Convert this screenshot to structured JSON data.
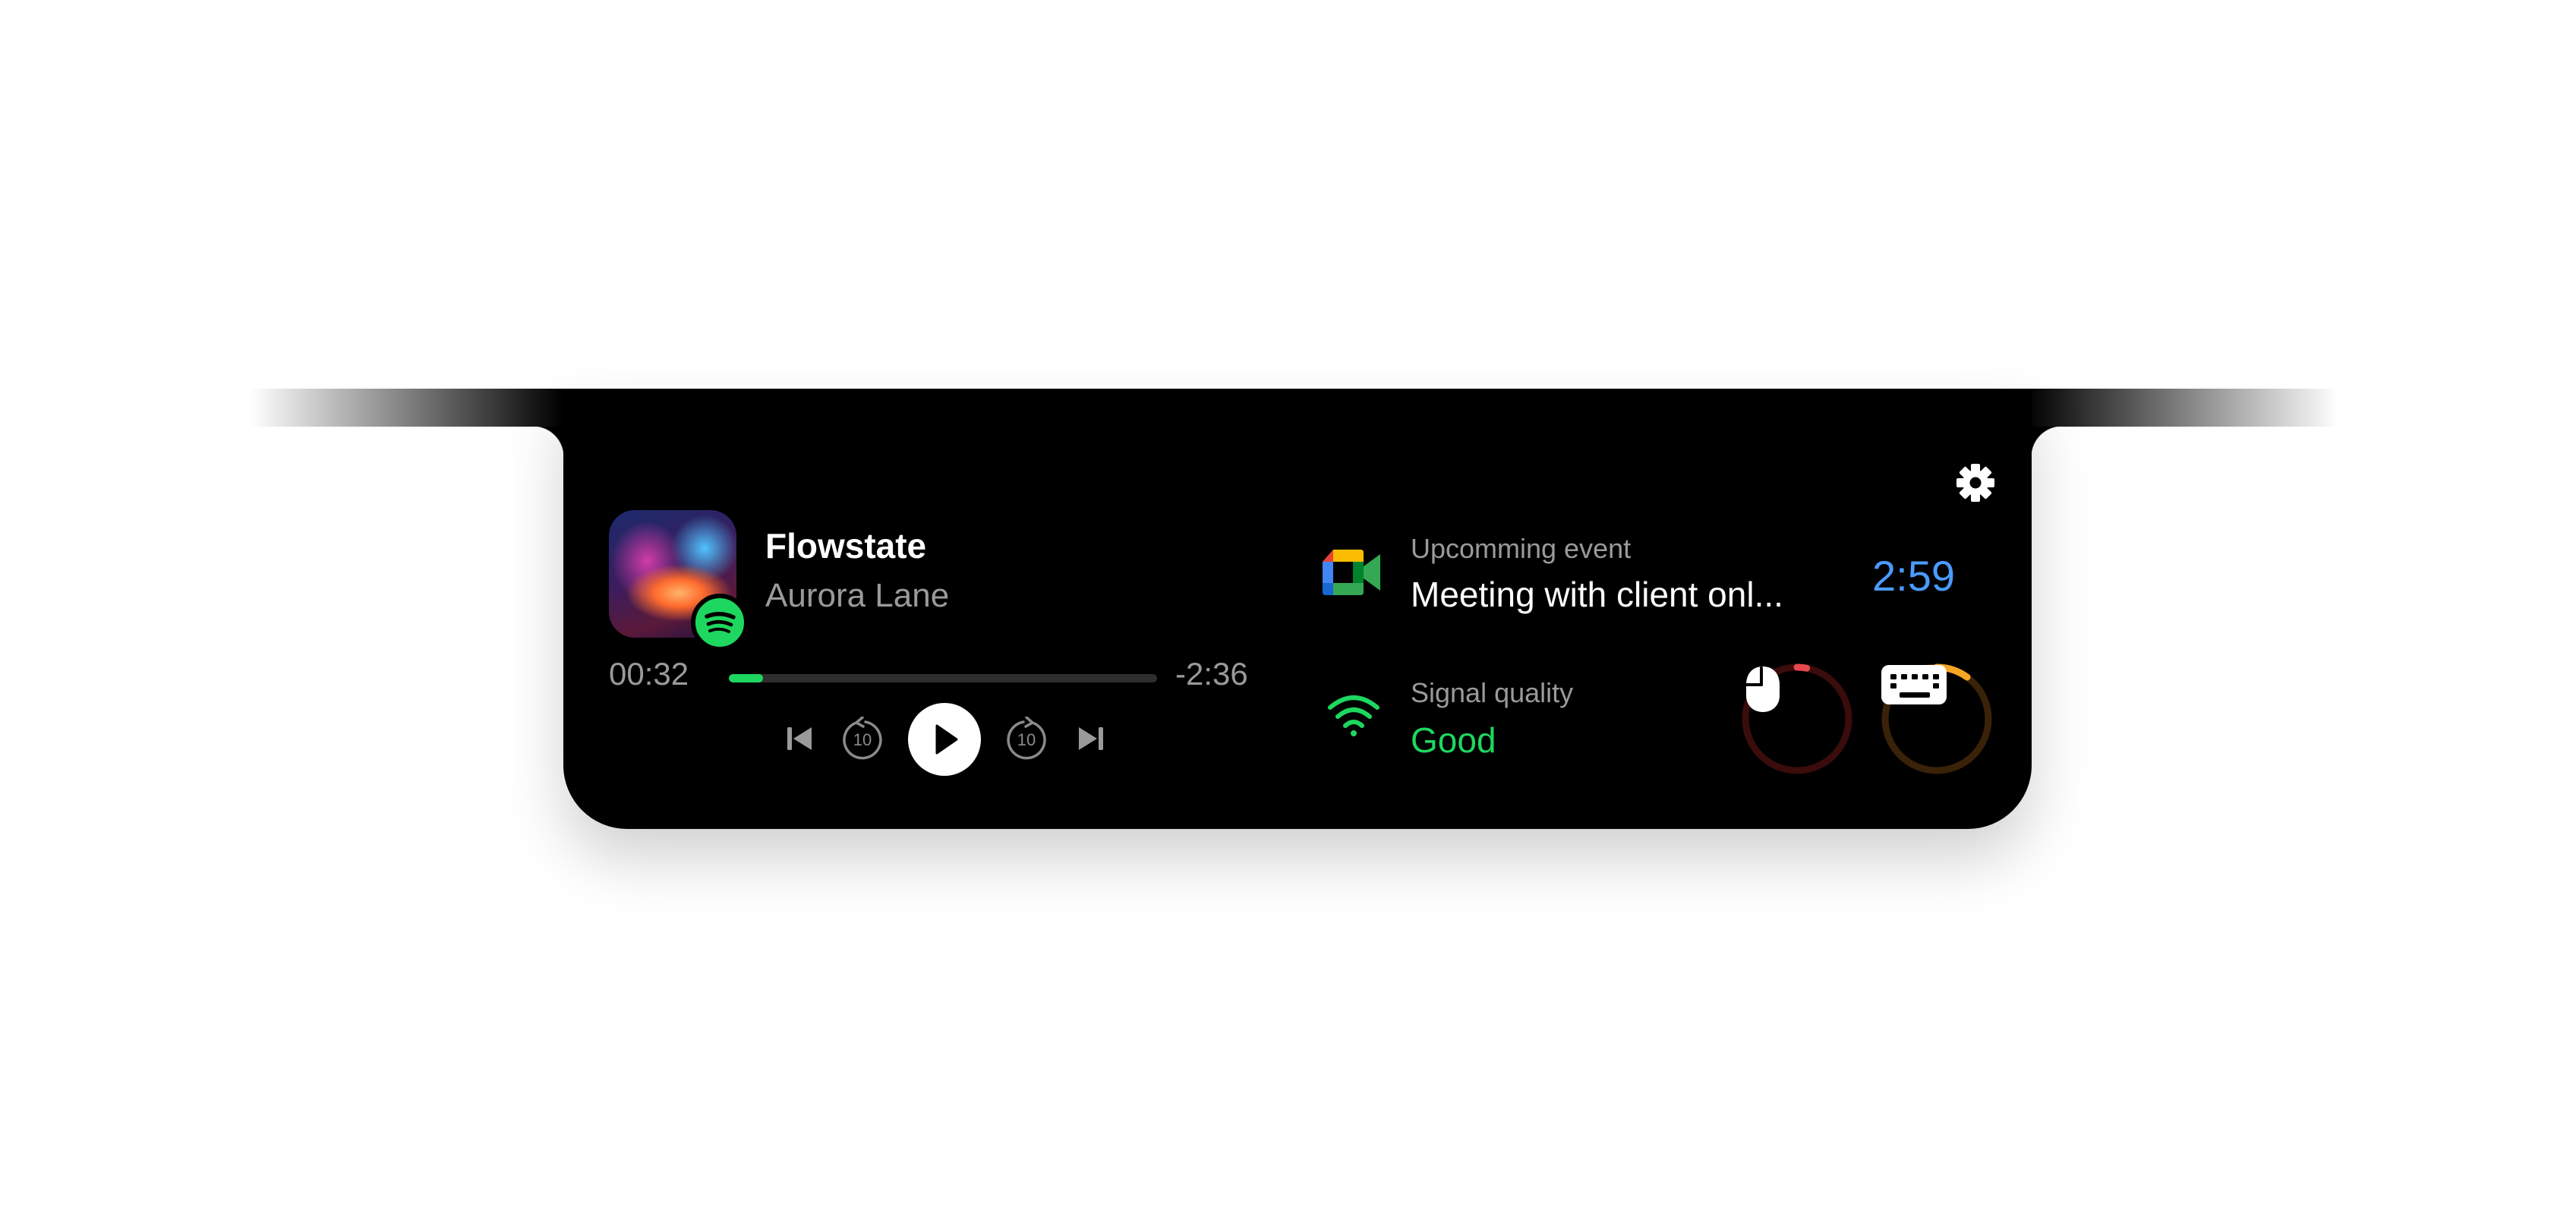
{
  "player": {
    "title": "Flowstate",
    "artist": "Aurora Lane",
    "elapsed": "00:32",
    "remaining": "-2:36",
    "progress": 0.08,
    "source_icon": "spotify-icon",
    "accent_color": "#1ed760",
    "skip_back_label": "10",
    "skip_forward_label": "10"
  },
  "event": {
    "label": "Upcomming event",
    "title": "Meeting with client onl...",
    "countdown": "2:59",
    "app_icon": "google-meet-icon",
    "countdown_color": "#4a9bff"
  },
  "signal": {
    "label": "Signal quality",
    "value": "Good",
    "icon": "wifi-icon",
    "value_color": "#1ed760"
  },
  "devices": [
    {
      "name": "mouse",
      "icon": "mouse-icon",
      "battery": 0.06,
      "color": "#e5484d",
      "track_color": "#3a0c0c"
    },
    {
      "name": "keyboard",
      "icon": "keyboard-icon",
      "battery": 0.2,
      "color": "#f5a623",
      "track_color": "#3a2208"
    }
  ]
}
